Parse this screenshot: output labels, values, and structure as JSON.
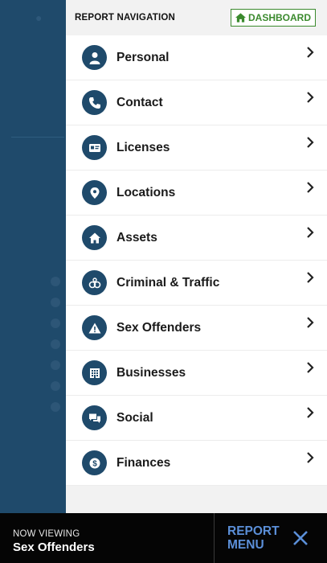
{
  "header": {
    "title": "REPORT NAVIGATION",
    "dashboard_label": "DASHBOARD"
  },
  "nav": {
    "items": [
      {
        "label": "Personal",
        "icon": "person-icon"
      },
      {
        "label": "Contact",
        "icon": "phone-icon"
      },
      {
        "label": "Licenses",
        "icon": "id-card-icon"
      },
      {
        "label": "Locations",
        "icon": "map-pin-icon"
      },
      {
        "label": "Assets",
        "icon": "home-icon"
      },
      {
        "label": "Criminal & Traffic",
        "icon": "handcuffs-icon"
      },
      {
        "label": "Sex Offenders",
        "icon": "warning-icon"
      },
      {
        "label": "Businesses",
        "icon": "building-icon"
      },
      {
        "label": "Social",
        "icon": "chat-icon"
      },
      {
        "label": "Finances",
        "icon": "dollar-icon"
      }
    ]
  },
  "footer": {
    "now_viewing_label": "NOW VIEWING",
    "now_viewing_value": "Sex Offenders",
    "menu_line1": "REPORT",
    "menu_line2": "MENU"
  },
  "colors": {
    "accent_blue": "#1f4a6b",
    "dashboard_green": "#3b8a2e",
    "menu_blue": "#5b8fd8"
  }
}
